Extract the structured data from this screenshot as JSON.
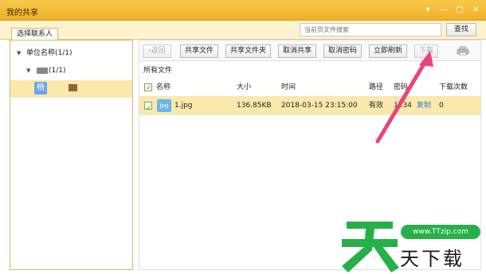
{
  "window": {
    "title": "我的共享",
    "controls": [
      "▾",
      "—",
      "□",
      "✕"
    ]
  },
  "tabs": {
    "contacts": "选择联系人"
  },
  "search": {
    "placeholder": "当前页文件搜索",
    "button": "查找"
  },
  "tree": {
    "root": "单位名称(1/1)",
    "dept": "(1/1)",
    "person_initial": "杨"
  },
  "toolbar": {
    "back": "返回",
    "share_file": "共享文件",
    "share_folder": "共享文件夹",
    "cancel_share": "取消共享",
    "cancel_password": "取消密码",
    "refresh": "立即刷新",
    "download": "下载"
  },
  "section": {
    "label": "所有文件"
  },
  "table": {
    "headers": [
      "名称",
      "大小",
      "时间",
      "路径",
      "密码",
      "下载次数"
    ],
    "rows": [
      {
        "icon": "jpg",
        "name": "1.jpg",
        "size": "136.85KB",
        "time": "2018-03-15 23:15:00",
        "path": "有效",
        "password": "1234",
        "copy": "复制",
        "downloads": "0"
      }
    ]
  },
  "watermark": {
    "url": "www.TTzip.com",
    "text": "天下载"
  },
  "colors": {
    "titlebar": "#f0b02a",
    "selection": "#fbe8ac",
    "arrow": "#e8457a",
    "watermark": "#27b04a"
  }
}
